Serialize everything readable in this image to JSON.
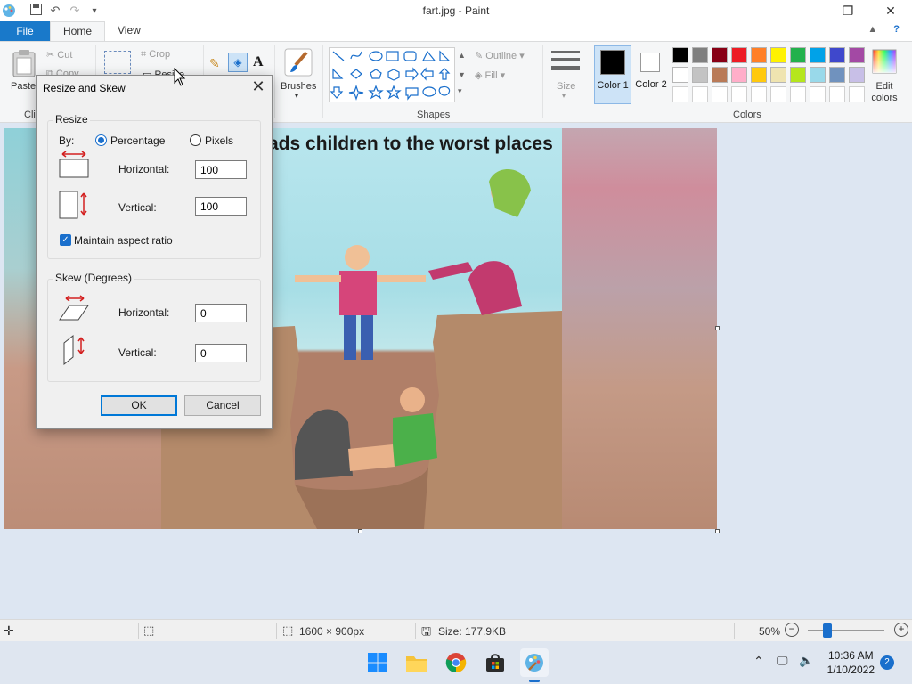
{
  "window": {
    "title": "fart.jpg - Paint"
  },
  "tabs": {
    "file": "File",
    "home": "Home",
    "view": "View"
  },
  "ribbon": {
    "clipboard": {
      "paste": "Paste",
      "cut": "Cut",
      "copy": "Copy",
      "label": "Clipboard"
    },
    "image": {
      "crop": "Crop",
      "resize": "Resize"
    },
    "brushes": "Brushes",
    "outline": "Outline",
    "fill": "Fill",
    "size": "Size",
    "shapes_label": "Shapes",
    "color1": "Color 1",
    "color2": "Color 2",
    "edit_colors": "Edit colors",
    "colors_label": "Colors",
    "palette_row1": [
      "#000000",
      "#7f7f7f",
      "#880015",
      "#ed1c24",
      "#ff7f27",
      "#fff200",
      "#22b14c",
      "#00a2e8",
      "#3f48cc",
      "#a349a4"
    ],
    "palette_row2": [
      "#ffffff",
      "#c3c3c3",
      "#b97a57",
      "#ffaec9",
      "#ffc90e",
      "#efe4b0",
      "#b5e61d",
      "#99d9ea",
      "#7092be",
      "#c8bfe7"
    ]
  },
  "canvas": {
    "caption": "ads children to the worst places"
  },
  "dialog": {
    "title": "Resize and Skew",
    "resize_legend": "Resize",
    "by_label": "By:",
    "percentage": "Percentage",
    "pixels": "Pixels",
    "horizontal_label": "Horizontal:",
    "vertical_label": "Vertical:",
    "resize_horizontal": "100",
    "resize_vertical": "100",
    "maintain_aspect": "Maintain aspect ratio",
    "skew_legend": "Skew (Degrees)",
    "skew_horizontal": "0",
    "skew_vertical": "0",
    "ok": "OK",
    "cancel": "Cancel"
  },
  "status": {
    "dimensions": "1600 × 900px",
    "size": "Size: 177.9KB",
    "zoom": "50%"
  },
  "taskbar": {
    "time": "10:36 AM",
    "date": "1/10/2022",
    "notifications": "2"
  }
}
